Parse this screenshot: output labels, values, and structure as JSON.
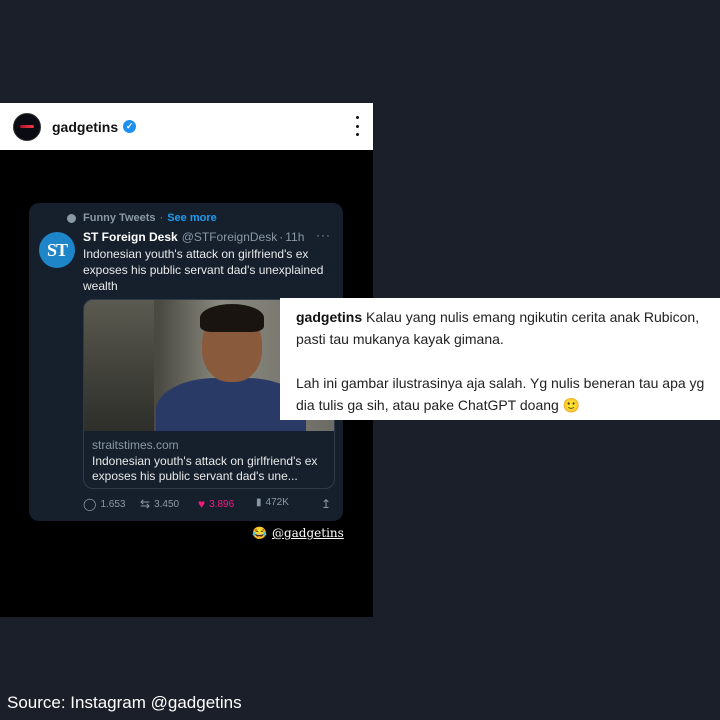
{
  "instagram": {
    "username": "gadgetins",
    "verified_icon": "✓",
    "more_icon": "more-vertical-icon"
  },
  "tweet": {
    "social_context": "Funny Tweets",
    "social_sep": "·",
    "see_more": "See more",
    "avatar_text": "ST",
    "name": "ST Foreign Desk",
    "handle": "@STForeignDesk",
    "sep": "·",
    "time": "11h",
    "menu": "···",
    "text": "Indonesian youth's attack on girlfriend's ex exposes his public servant dad's unexplained wealth",
    "link_domain": "straitstimes.com",
    "link_title": "Indonesian youth's attack on girlfriend's ex exposes his public servant dad's une...",
    "replies": "1.653",
    "retweets": "3.450",
    "likes": "3.896",
    "views": "472K"
  },
  "mention": {
    "emoji": "😂",
    "handle": "@gadgetins"
  },
  "comment": {
    "user": "gadgetins",
    "line1": "Kalau yang nulis emang ngikutin cerita anak Rubicon, pasti tau mukanya kayak gimana.",
    "line2": "Lah ini gambar ilustrasinya aja salah. Yg nulis beneran tau apa yg dia tulis ga sih, atau pake ChatGPT doang 🙂"
  },
  "footer": {
    "source": "Source: Instagram @gadgetins"
  }
}
